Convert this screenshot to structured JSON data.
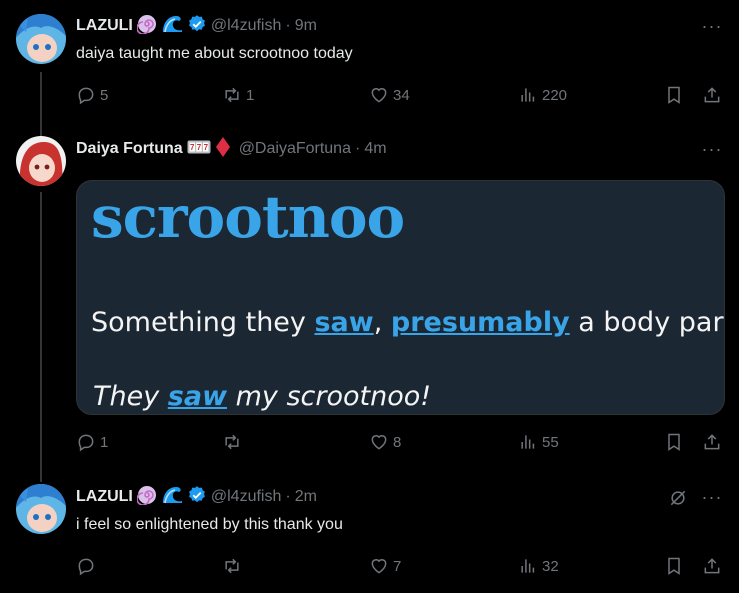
{
  "tweets": [
    {
      "name": "LAZULI",
      "handle": "@l4zufish",
      "time": "9m",
      "text": "daiya taught me about scrootnoo today",
      "replies": "5",
      "reposts": "1",
      "likes": "34",
      "views": "220"
    },
    {
      "name": "Daiya Fortuna",
      "handle": "@DaiyaFortuna",
      "time": "4m",
      "replies": "1",
      "reposts": "",
      "likes": "8",
      "views": "55",
      "media": {
        "word": "scrootnoo",
        "def_before": "Something they ",
        "def_link1": "saw",
        "def_mid": ", ",
        "def_link2": "presumably",
        "def_after": " a body part- Lik",
        "ex_before": "They ",
        "ex_link": "saw",
        "ex_after": " my scrootnoo!"
      }
    },
    {
      "name": "LAZULI",
      "handle": "@l4zufish",
      "time": "2m",
      "text": "i feel so enlightened by this thank you",
      "replies": "",
      "reposts": "",
      "likes": "7",
      "views": "32"
    }
  ],
  "separator": "·",
  "more_label": "···",
  "colors": {
    "verified": "#1d9bf0",
    "muted": "#71767b",
    "link": "#3aa4e8",
    "card_bg": "#1b2733"
  }
}
